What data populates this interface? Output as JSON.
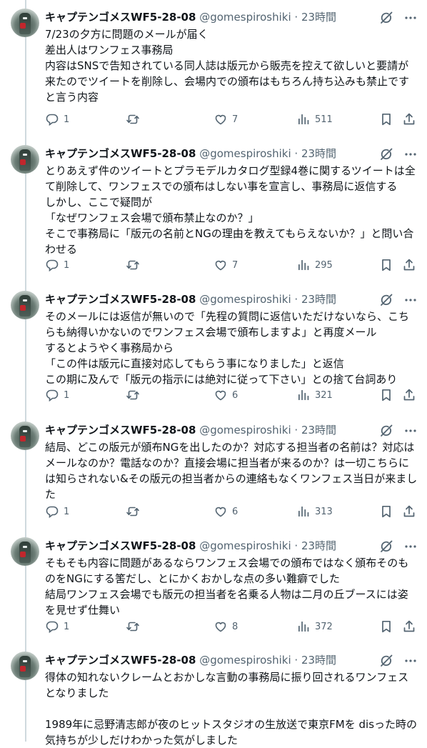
{
  "tweets": [
    {
      "name": "キャプテンゴメスWF5-28-08",
      "handle": "@gomespiroshiki",
      "time": "· 23時間",
      "body": "7/23の夕方に問題のメールが届く\n差出人はワンフェス事務局\n内容はSNSで告知されている同人誌は版元から販売を控えて欲しいと要請が来たのでツイートを削除し、会場内での頒布はもちろん持ち込みも禁止です\nと言う内容",
      "replies": "1",
      "retweets": "",
      "likes": "7",
      "views": "511"
    },
    {
      "name": "キャプテンゴメスWF5-28-08",
      "handle": "@gomespiroshiki",
      "time": "· 23時間",
      "body": "とりあえず件のツイートとプラモデルカタログ型録4巻に関するツイートは全て削除して、ワンフェスでの頒布はしない事を宣言し、事務局に返信する\nしかし、ここで疑問が\n「なぜワンフェス会場で頒布禁止なのか？」\nそこで事務局に「版元の名前とNGの理由を教えてもらえないか？」と問い合わせる",
      "replies": "1",
      "retweets": "",
      "likes": "7",
      "views": "295"
    },
    {
      "name": "キャプテンゴメスWF5-28-08",
      "handle": "@gomespiroshiki",
      "time": "· 23時間",
      "body": "そのメールには返信が無いので「先程の質問に返信いただけないなら、こちらも納得いかないのでワンフェス会場で頒布しますよ」と再度メール\nするとようやく事務局から\n「この件は版元に直接対応してもらう事になりました」と返信\nこの期に及んで「版元の指示には絶対に従って下さい」との捨て台詞あり",
      "replies": "1",
      "retweets": "",
      "likes": "6",
      "views": "321"
    },
    {
      "name": "キャプテンゴメスWF5-28-08",
      "handle": "@gomespiroshiki",
      "time": "· 23時間",
      "body": "結局、どこの版元が頒布NGを出したのか？対応する担当者の名前は？対応はメールなのか？電話なのか？直接会場に担当者が来るのか？は一切こちらには知らされない&その版元の担当者からの連絡もなくワンフェス当日が来ました",
      "replies": "1",
      "retweets": "",
      "likes": "6",
      "views": "313"
    },
    {
      "name": "キャプテンゴメスWF5-28-08",
      "handle": "@gomespiroshiki",
      "time": "· 23時間",
      "body": "そもそも内容に問題があるならワンフェス会場での頒布ではなく頒布そのものをNGにする筈だし、とにかくおかしな点の多い難癖でした\n結局ワンフェス会場でも版元の担当者を名乗る人物は二月の丘ブースには姿を見せず仕舞い",
      "replies": "1",
      "retweets": "",
      "likes": "8",
      "views": "372"
    },
    {
      "name": "キャプテンゴメスWF5-28-08",
      "handle": "@gomespiroshiki",
      "time": "· 23時間",
      "body": "得体の知れないクレームとおかしな言動の事務局に振り回されるワンフェスとなりました\n\n1989年に忌野清志郎が夜のヒットスタジオの生放送で東京FMを disった時の気持ちが少しだけわかった気がしました"
    }
  ],
  "colors": {
    "text": "#0f1419",
    "muted": "#536471",
    "line": "#cfd9de"
  }
}
